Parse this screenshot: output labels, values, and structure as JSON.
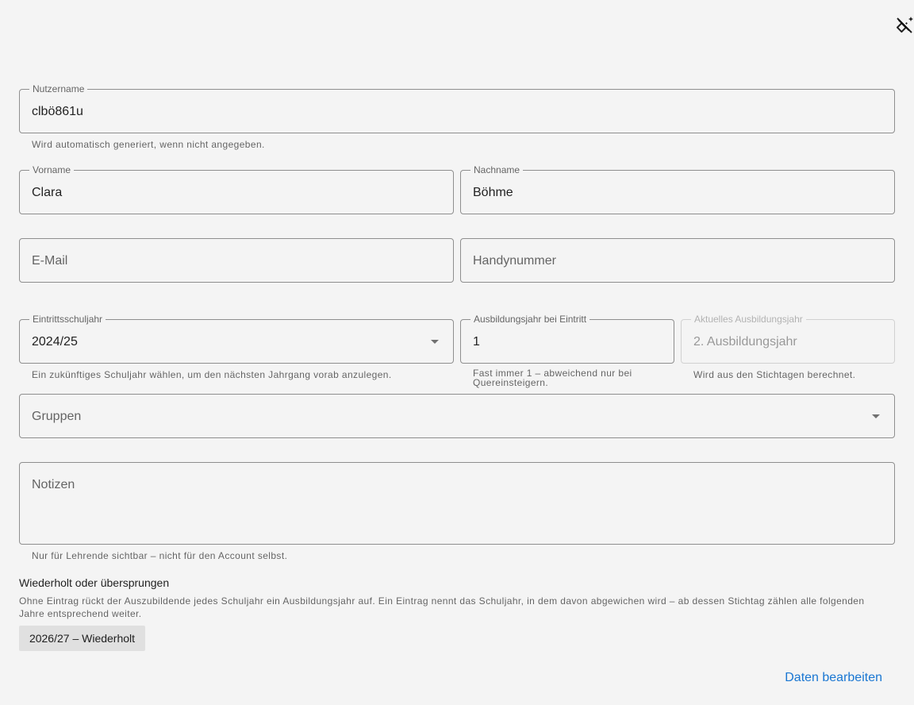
{
  "toolbar": {
    "corner_icon": "auto-fix-off-icon"
  },
  "form": {
    "username": {
      "label": "Nutzername",
      "value": "clbö861u",
      "helper": "Wird automatisch generiert, wenn nicht angegeben."
    },
    "firstname": {
      "label": "Vorname",
      "value": "Clara"
    },
    "lastname": {
      "label": "Nachname",
      "value": "Böhme"
    },
    "email": {
      "placeholder": "E-Mail"
    },
    "mobile": {
      "placeholder": "Handynummer"
    },
    "entry_school_year": {
      "label": "Eintrittsschuljahr",
      "value": "2024/25",
      "helper": "Ein zukünftiges Schuljahr wählen, um den nächsten Jahrgang vorab anzulegen."
    },
    "training_year_at_entry": {
      "label": "Ausbildungsjahr bei Eintritt",
      "value": "1",
      "helper": "Fast immer 1 – abweichend nur bei Quereinsteigern."
    },
    "current_training_year": {
      "label": "Aktuelles Ausbildungsjahr",
      "value": "2. Ausbildungsjahr",
      "helper": "Wird aus den Stichtagen berechnet."
    },
    "groups": {
      "placeholder": "Gruppen"
    },
    "notes": {
      "placeholder": "Notizen",
      "helper": "Nur für Lehrende sichtbar – nicht für den Account selbst."
    }
  },
  "repeat_section": {
    "title": "Wiederholt oder übersprungen",
    "description": "Ohne Eintrag rückt der Auszubildende jedes Schuljahr ein Ausbildungsjahr auf. Ein Eintrag nennt das Schuljahr, in dem davon abgewichen wird – ab dessen Stichtag zählen alle folgenden Jahre entsprechend weiter.",
    "chips": [
      "2026/27 – Wiederholt"
    ]
  },
  "actions": {
    "edit_label": "Daten bearbeiten"
  },
  "colors": {
    "primary": "#1976d2",
    "background": "#f4f4f4",
    "chip": "#e0e0e0"
  }
}
